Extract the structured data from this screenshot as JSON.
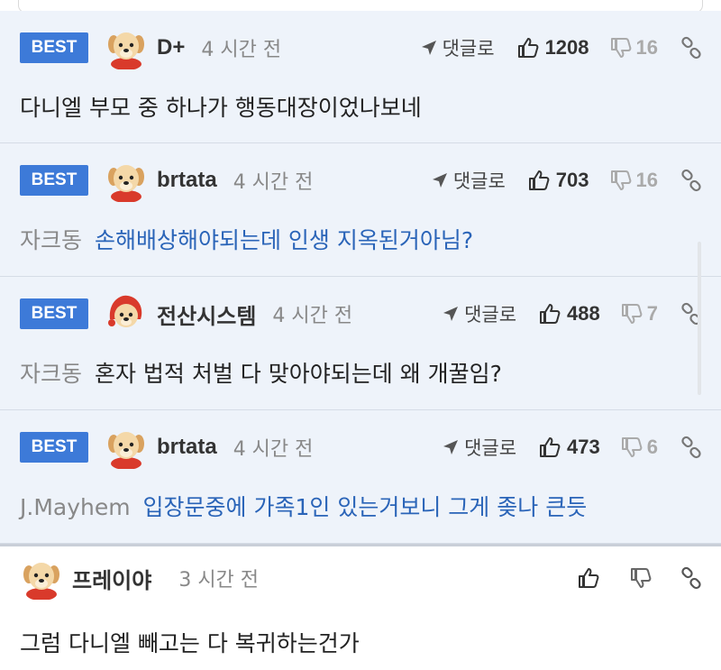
{
  "comments": [
    {
      "badge": "BEST",
      "nick": "D+",
      "time": "4 시간 전",
      "reply": "댓글로",
      "likes": "1208",
      "dislikes": "16",
      "mention": "",
      "text": "다니엘 부모 중 하나가 행동대장이었나보네"
    },
    {
      "badge": "BEST",
      "nick": "brtata",
      "time": "4 시간 전",
      "reply": "댓글로",
      "likes": "703",
      "dislikes": "16",
      "mention": "자크동",
      "text": "손해배상해야되는데 인생 지옥된거아님?"
    },
    {
      "badge": "BEST",
      "nick": "전산시스템",
      "time": "4 시간 전",
      "reply": "댓글로",
      "likes": "488",
      "dislikes": "7",
      "mention": "자크동",
      "text": "혼자 법적 처벌 다 맞아야되는데 왜 개꿀임?"
    },
    {
      "badge": "BEST",
      "nick": "brtata",
      "time": "4 시간 전",
      "reply": "댓글로",
      "likes": "473",
      "dislikes": "6",
      "mention": "J.Mayhem",
      "text": "입장문중에 가족1인 있는거보니 그게 좆나 큰듯"
    },
    {
      "nick": "프레이야",
      "time": "3 시간 전",
      "text": "그럼 다니엘 빼고는 다 복귀하는건가"
    }
  ],
  "icons": {
    "reply": "reply-arrow-icon",
    "like": "thumbs-up-icon",
    "dislike": "thumbs-down-icon",
    "link": "link-icon",
    "avatar": "puppy-avatar"
  },
  "colors": {
    "best_bg": "#eef3fa",
    "badge": "#3d7ad8",
    "link_text": "#2a64b8"
  }
}
